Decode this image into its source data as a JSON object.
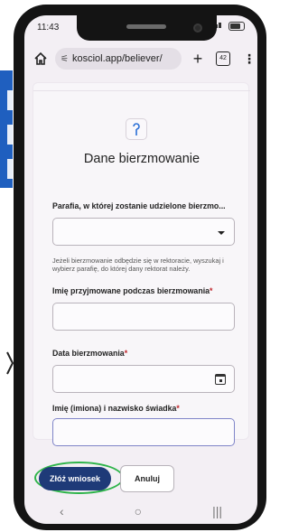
{
  "status": {
    "time": "11:43",
    "battery": "battery-icon",
    "signal_icons": "wifi-signal-icons"
  },
  "browser": {
    "url": "kosciol.app/believer/",
    "tab_count": "42",
    "tune_icon": "site-settings-icon"
  },
  "form": {
    "title": "Dane bierzmowanie",
    "parish_label": "Parafia, w której zostanie udzielone bierzmo...",
    "parish_help": "Jeżeli bierzmowanie odbędzie się w rektoracie, wyszukaj i wybierz parafię, do której dany rektorat należy.",
    "name_label": "Imię przyjmowane podczas bierzmowania",
    "date_label": "Data bierzmowania",
    "sponsor_label": "Imię (imiona) i nazwisko świadka",
    "required_mark": "*"
  },
  "actions": {
    "submit_label": "Złóż wniosek",
    "cancel_label": "Anuluj"
  },
  "nav": {
    "back": "‹",
    "home": "○",
    "recents": "|||"
  },
  "colors": {
    "primary": "#1e3a78",
    "annotation": "#2eb44a",
    "required": "#c0242a"
  }
}
